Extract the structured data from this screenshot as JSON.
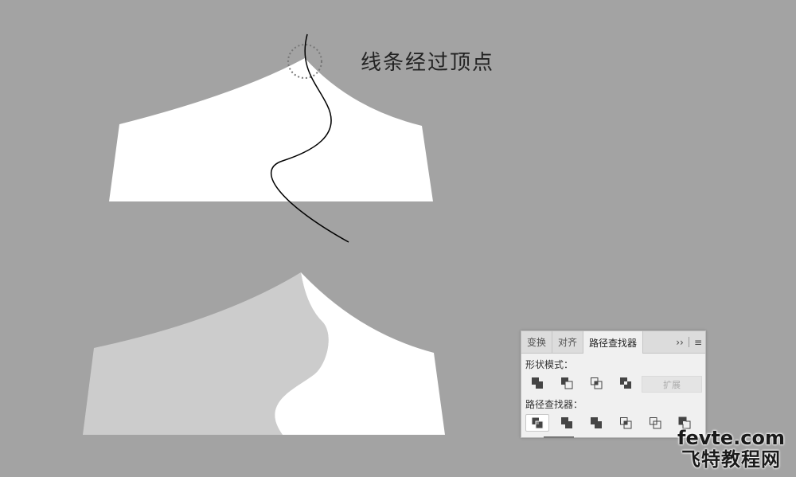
{
  "caption": "线条经过顶点",
  "panel": {
    "tabs": [
      {
        "label": "变换",
        "active": false
      },
      {
        "label": "对齐",
        "active": false
      },
      {
        "label": "路径查找器",
        "active": true
      }
    ],
    "more_glyph": "››",
    "menu_glyph": "≡",
    "shape_modes_label": "形状模式：",
    "shape_modes": [
      "unite-icon",
      "minus-front-icon",
      "intersect-icon",
      "exclude-icon"
    ],
    "expand_label": "扩展",
    "pathfinders_label": "路径查找器：",
    "pathfinders": [
      "divide-icon",
      "trim-icon",
      "merge-icon",
      "crop-icon",
      "outline-icon",
      "minus-back-icon"
    ]
  },
  "watermark": {
    "site": "fevte.com",
    "name": "飞特教程网"
  },
  "colors": {
    "canvas": "#a3a3a3",
    "shape_white": "#ffffff",
    "shape_gray": "#cccccc",
    "stroke": "#000000"
  }
}
